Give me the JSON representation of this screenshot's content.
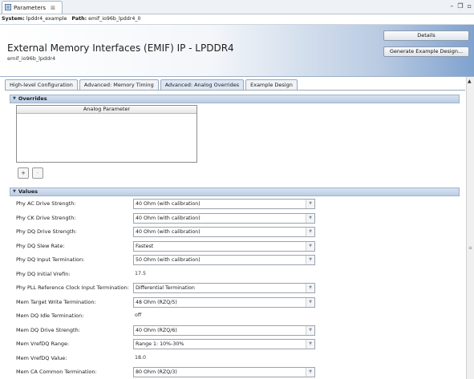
{
  "view_tab": {
    "title": "Parameters",
    "close": "⊠"
  },
  "window_controls": {
    "minimize": "–",
    "maximize": "❐",
    "close": "▫"
  },
  "path_line": {
    "system_label": "System:",
    "system_value": "lpddr4_example",
    "path_label": "Path:",
    "path_value": "emif_io96b_lpddr4_0"
  },
  "header": {
    "title": "External Memory Interfaces (EMIF) IP - LPDDR4",
    "subtitle": "emif_io96b_lpddr4",
    "details_button": "Details",
    "generate_button": "Generate Example Design..."
  },
  "tabs": [
    {
      "label": "High-level Configuration",
      "active": false
    },
    {
      "label": "Advanced: Memory Timing",
      "active": false
    },
    {
      "label": "Advanced: Analog Overrides",
      "active": true
    },
    {
      "label": "Example Design",
      "active": false
    }
  ],
  "overrides": {
    "section_label": "Overrides",
    "table_header": "Analog Parameter",
    "add_button": "+",
    "remove_button": "-"
  },
  "values": {
    "section_label": "Values",
    "rows": [
      {
        "label": "Phy AC Drive Strength:",
        "value": "40 Ohm (with calibration)",
        "type": "combo"
      },
      {
        "label": "Phy CK Drive Strength:",
        "value": "40 Ohm (with calibration)",
        "type": "combo"
      },
      {
        "label": "Phy DQ Drive Strength:",
        "value": "40 Ohm (with calibration)",
        "type": "combo"
      },
      {
        "label": "Phy DQ Slew Rate:",
        "value": "Fastest",
        "type": "combo"
      },
      {
        "label": "Phy DQ Input Termination:",
        "value": "50 Ohm (with calibration)",
        "type": "combo"
      },
      {
        "label": "Phy DQ Initial Vrefin:",
        "value": "17.5",
        "type": "readonly"
      },
      {
        "label": "Phy PLL Reference Clock Input Termination:",
        "value": "Differential Termination",
        "type": "combo"
      },
      {
        "label": "Mem Target Write Termination:",
        "value": "48 Ohm (RZQ/5)",
        "type": "combo"
      },
      {
        "label": "Mem DQ Idle Termination:",
        "value": "off",
        "type": "readonly"
      },
      {
        "label": "Mem DQ Drive Strength:",
        "value": "40 Ohm (RZQ/6)",
        "type": "combo"
      },
      {
        "label": "Mem VrefDQ Range:",
        "value": "Range 1: 10%-30%",
        "type": "combo"
      },
      {
        "label": "Mem VrefDQ Value:",
        "value": "18.0",
        "type": "readonly"
      },
      {
        "label": "Mem CA Common Termination:",
        "value": "80 Ohm (RZQ/3)",
        "type": "combo"
      }
    ]
  },
  "icons": {
    "dropdown": "▼",
    "section_toggle": "▼",
    "scroll_up": "▲",
    "scroll_grip": "≡",
    "view_tab_icon": "parameters-icon"
  }
}
